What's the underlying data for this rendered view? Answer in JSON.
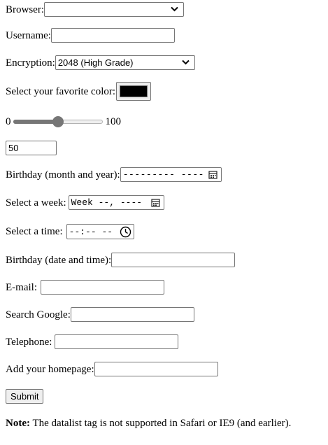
{
  "browser": {
    "label": "Browser:",
    "value": ""
  },
  "username": {
    "label": "Username:",
    "value": ""
  },
  "encryption": {
    "label": "Encryption:",
    "value": "2048 (High Grade)"
  },
  "color": {
    "label": "Select your favorite color:",
    "value": "#000000"
  },
  "range": {
    "min_label": "0",
    "max_label": "100",
    "value_fraction": 0.5
  },
  "number": {
    "value": "50"
  },
  "birthday_month": {
    "label": "Birthday (month and year):",
    "placeholder": "--------- ----"
  },
  "week": {
    "label": "Select a week:",
    "placeholder": "Week --, ----"
  },
  "time": {
    "label": "Select a time:",
    "placeholder": "--:-- --"
  },
  "birthday_datetime": {
    "label": "Birthday (date and time):",
    "value": ""
  },
  "email": {
    "label": "E-mail:",
    "value": ""
  },
  "search_google": {
    "label": "Search Google:",
    "value": ""
  },
  "telephone": {
    "label": "Telephone:",
    "value": ""
  },
  "homepage": {
    "label": "Add your homepage:",
    "value": ""
  },
  "submit": {
    "label": "Submit"
  },
  "note": {
    "bold": "Note:",
    "text": " The datalist tag is not supported in Safari or IE9 (and earlier)."
  },
  "icons": {
    "dropdown": "chevron-down-icon",
    "calendar": "calendar-icon",
    "clock": "clock-icon"
  }
}
